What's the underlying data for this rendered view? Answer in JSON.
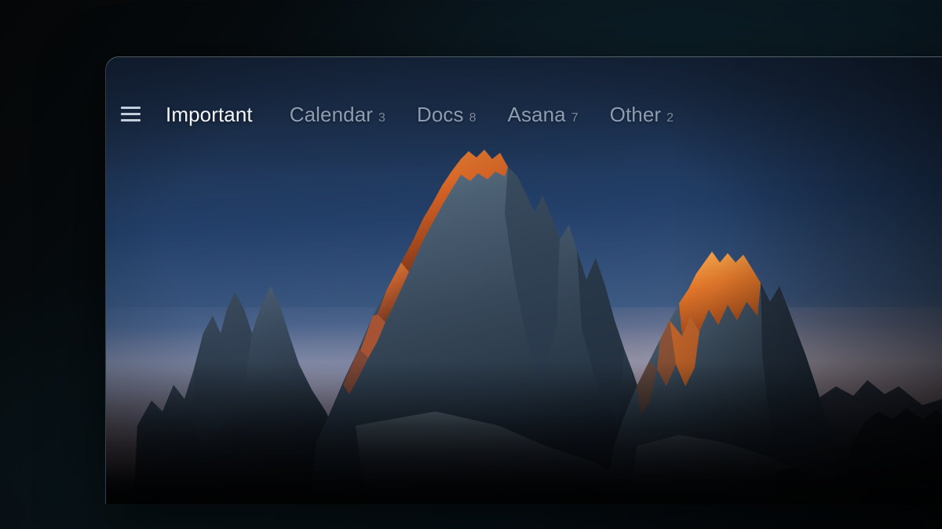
{
  "window": {
    "title": "Important",
    "wallpaper_description": "Tre Cime di Lavaredo dolomite peaks at alpenglow dusk"
  },
  "toolbar": {
    "menu_icon": "hamburger-menu-icon",
    "menu_label": "Menu",
    "tabs": [
      {
        "label": "Important",
        "count": "",
        "active": true
      },
      {
        "label": "Calendar",
        "count": "3",
        "active": false
      },
      {
        "label": "Docs",
        "count": "8",
        "active": false
      },
      {
        "label": "Asana",
        "count": "7",
        "active": false
      },
      {
        "label": "Other",
        "count": "2",
        "active": false
      }
    ]
  },
  "colors": {
    "desktop_background": "#050607",
    "window_background": "#1c2b40",
    "active_tab_text": "#f2f5f9",
    "inactive_tab_text": "#8e9cb0",
    "count_text": "#7c8a9d",
    "menu_icon": "#c3cedd",
    "window_border": "#bfcddc",
    "sky_top": "#18273f",
    "sky_horizon": "#95808c",
    "alpenglow": "#d6712c",
    "rock_light": "#7d8d9e",
    "rock_dark": "#1c2836"
  }
}
